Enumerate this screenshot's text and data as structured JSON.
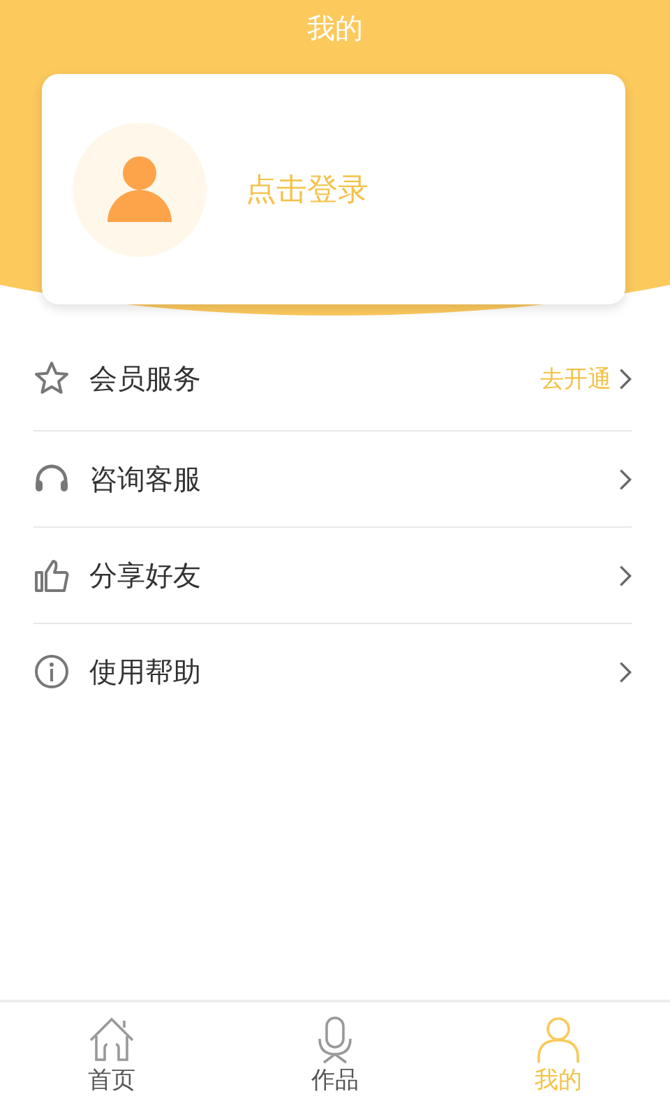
{
  "header": {
    "title": "我的"
  },
  "profile": {
    "login_text": "点击登录"
  },
  "menu": [
    {
      "kind": "star",
      "label": "会员服务",
      "action": "去开通"
    },
    {
      "kind": "headset",
      "label": "咨询客服"
    },
    {
      "kind": "thumb",
      "label": "分享好友"
    },
    {
      "kind": "info",
      "label": "使用帮助"
    }
  ],
  "tab_bar": [
    {
      "kind": "home",
      "label": "首页",
      "selected": false
    },
    {
      "kind": "mic",
      "label": "作品",
      "selected": false
    },
    {
      "kind": "person",
      "label": "我的",
      "selected": true
    }
  ]
}
